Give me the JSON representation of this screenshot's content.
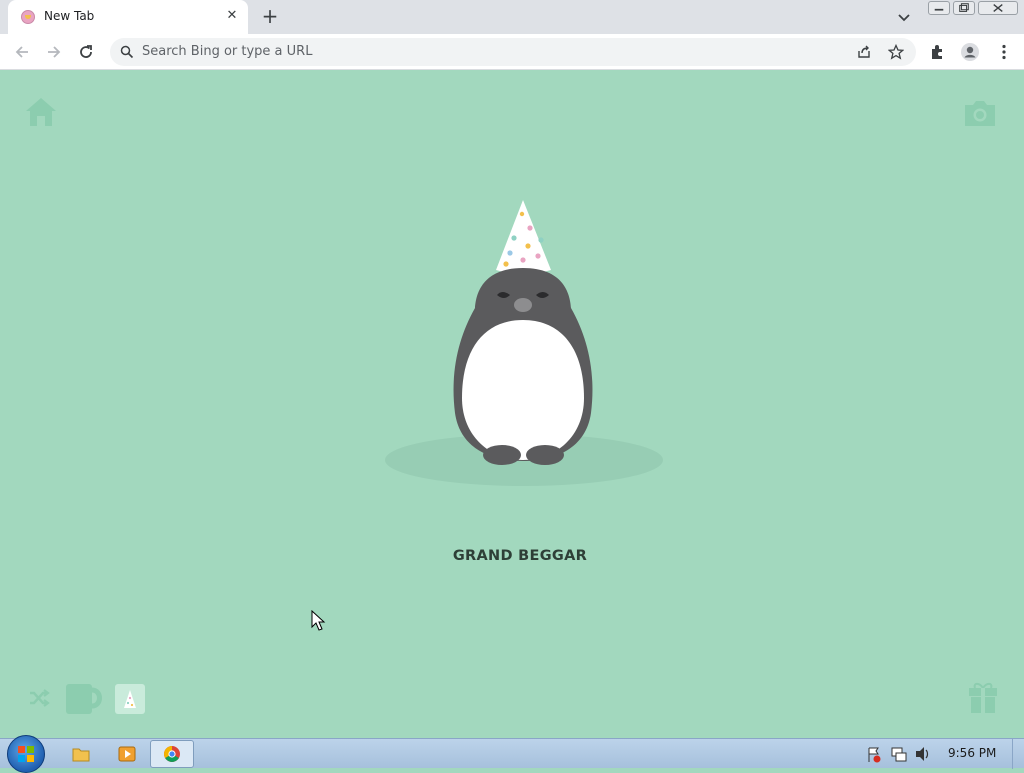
{
  "browser": {
    "tab": {
      "title": "New Tab",
      "close_glyph": "✕"
    },
    "new_tab_glyph": "+",
    "omnibox": {
      "placeholder": "Search Bing or type a URL"
    }
  },
  "page": {
    "character_name": "GRAND BEGGAR"
  },
  "taskbar": {
    "clock": "9:56 PM"
  },
  "colors": {
    "background": "#a2d8be",
    "accent_icon": "#8ccdaf",
    "penguin_body": "#5b5b5d",
    "penguin_belly": "#ffffff"
  },
  "icons": [
    "home-icon",
    "camera-icon",
    "shuffle-icon",
    "mug-icon",
    "party-hat-icon",
    "gift-icon",
    "search-icon",
    "share-icon",
    "star-icon",
    "extensions-icon",
    "profile-icon",
    "menu-icon"
  ]
}
